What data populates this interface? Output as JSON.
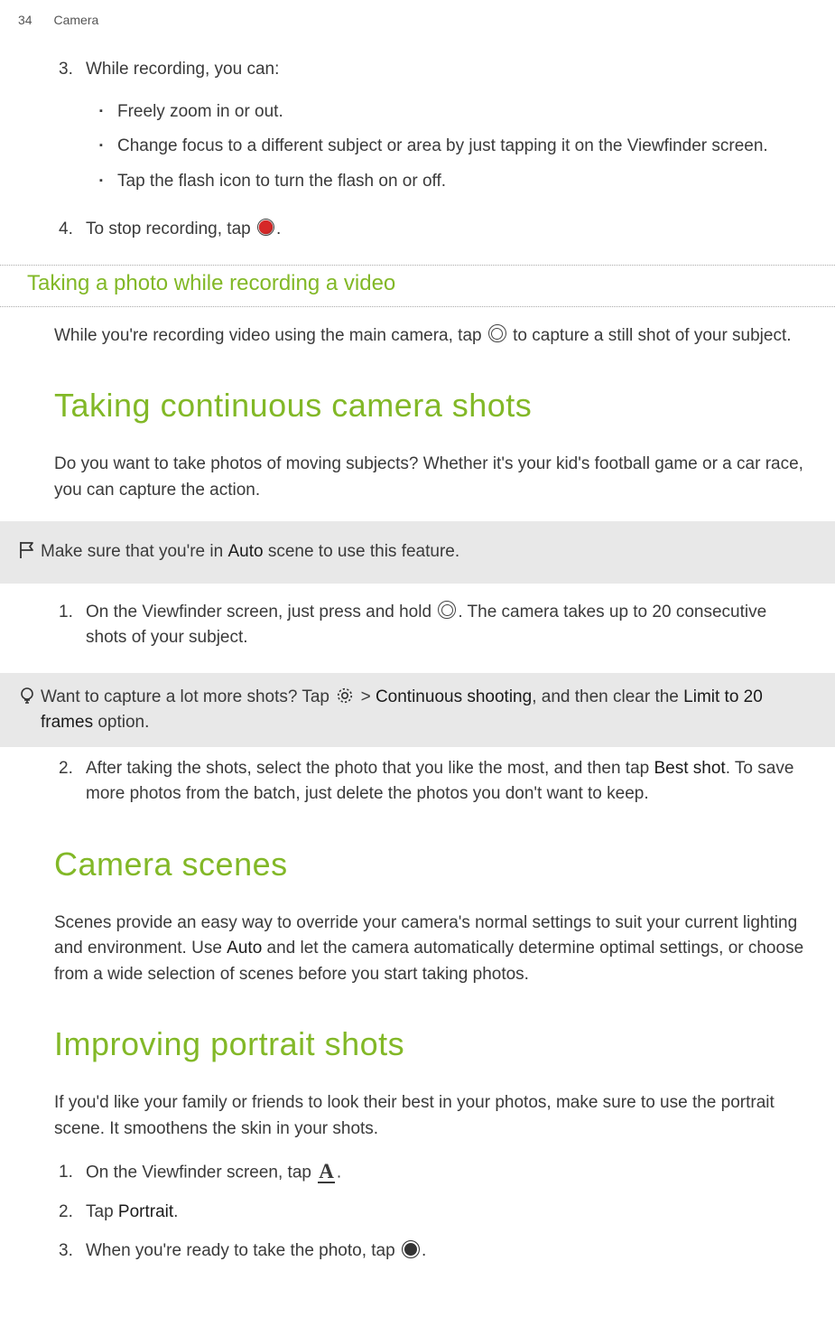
{
  "page_header": {
    "number": "34",
    "section": "Camera"
  },
  "recording_list": {
    "items": [
      {
        "num": "3.",
        "text": "While recording, you can:",
        "sub": [
          "Freely zoom in or out.",
          "Change focus to a different subject or area by just tapping it on the Viewfinder screen.",
          "Tap the flash icon to turn the flash on or off."
        ]
      },
      {
        "num": "4.",
        "text_before": "To stop recording, tap ",
        "text_after": "."
      }
    ]
  },
  "photo_while_video": {
    "heading": "Taking a photo while recording a video",
    "text_before": "While you're recording video using the main camera, tap ",
    "text_after": " to capture a still shot of your subject."
  },
  "continuous_shots": {
    "heading": "Taking continuous camera shots",
    "intro": "Do you want to take photos of moving subjects? Whether it's your kid's football game or a car race, you can capture the action.",
    "flag_note_before": "Make sure that you're in ",
    "flag_note_bold": "Auto",
    "flag_note_after": " scene to use this feature.",
    "step1_num": "1.",
    "step1_before": "On the Viewfinder screen, just press and hold ",
    "step1_after": ". The camera takes up to 20 consecutive shots of your subject.",
    "tip_before": "Want to capture a lot more shots? Tap ",
    "tip_mid_before": " > ",
    "tip_bold1": "Continuous shooting",
    "tip_mid_after": ", and then clear the ",
    "tip_bold2": "Limit to 20 frames",
    "tip_end": " option.",
    "step2_num": "2.",
    "step2_before": "After taking the shots, select the photo that you like the most, and then tap ",
    "step2_bold": "Best shot",
    "step2_after": ". To save more photos from the batch, just delete the photos you don't want to keep."
  },
  "camera_scenes": {
    "heading": "Camera scenes",
    "text_before": "Scenes provide an easy way to override your camera's normal settings to suit your current lighting and environment. Use ",
    "text_bold": "Auto",
    "text_after": " and let the camera automatically determine optimal settings, or choose from a wide selection of scenes before you start taking photos."
  },
  "portrait_shots": {
    "heading": "Improving portrait shots",
    "intro": "If you'd like your family or friends to look their best in your photos, make sure to use the portrait scene. It smoothens the skin in your shots.",
    "steps": [
      {
        "num": "1.",
        "text_before": "On the Viewfinder screen, tap ",
        "text_after": "."
      },
      {
        "num": "2.",
        "text_before": "Tap ",
        "text_bold": "Portrait",
        "text_after": "."
      },
      {
        "num": "3.",
        "text_before": "When you're ready to take the photo, tap ",
        "text_after": "."
      }
    ]
  }
}
